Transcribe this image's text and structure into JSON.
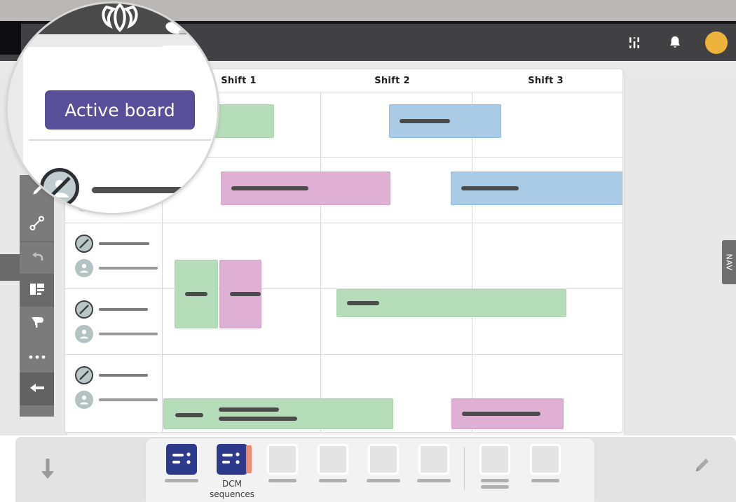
{
  "app": {
    "logo_icon": "crown-logo-icon",
    "topbar": {
      "settings_icon": "sliders-icon",
      "notifications_icon": "bell-icon",
      "avatar_label": "",
      "avatar_color": "#eeb33a",
      "background_color": "#414143"
    }
  },
  "magnifier": {
    "active_board_label": "Active board",
    "button_color": "#584f9b",
    "cursor_icon": "cursor-arrow-icon",
    "blocked_icon": "no-entry-icon",
    "redacted_line": ""
  },
  "left_rail": {
    "items": [
      {
        "name": "pen-tool",
        "icon": "pen-icon"
      },
      {
        "name": "connector-tool",
        "icon": "link-line-icon"
      },
      {
        "name": "undo",
        "icon": "undo-arrow-icon"
      },
      {
        "name": "card-layout",
        "icon": "card-layout-icon"
      },
      {
        "name": "filter",
        "icon": "funnel-icon"
      },
      {
        "name": "more-options",
        "icon": "ellipsis-icon"
      },
      {
        "name": "collapse-back",
        "icon": "arrow-left-icon"
      }
    ]
  },
  "nav_tab": {
    "label": "NAV"
  },
  "board": {
    "columns": [
      "Shift 1",
      "Shift 2",
      "Shift 3"
    ],
    "rows": [
      {
        "assignee_icon": "no-entry-icon",
        "assignee_redacted": "",
        "person_icon": "person-icon",
        "person_redacted": ""
      },
      {
        "assignee_icon": "no-entry-icon",
        "assignee_redacted": "",
        "person_icon": "person-icon",
        "person_redacted": ""
      },
      {
        "assignee_icon": "no-entry-icon",
        "assignee_redacted": "",
        "person_icon": "person-icon",
        "person_redacted": ""
      },
      {
        "assignee_icon": "no-entry-icon",
        "assignee_redacted": "",
        "person_icon": "person-icon",
        "person_redacted": ""
      },
      {
        "assignee_icon": "no-entry-icon",
        "assignee_redacted": "",
        "person_icon": "person-icon",
        "person_redacted": ""
      }
    ],
    "tasks": [
      {
        "id": "task-green-r1c1",
        "color": "green",
        "label": "",
        "lines": 0
      },
      {
        "id": "task-blue-r1c2",
        "color": "blue",
        "label": "",
        "lines": 1
      },
      {
        "id": "task-pink-r2c1",
        "color": "pink",
        "label": "",
        "lines": 1
      },
      {
        "id": "task-blue-r2c3",
        "color": "blue",
        "label": "",
        "lines": 1
      },
      {
        "id": "task-green-r3c1",
        "color": "green",
        "label": "",
        "lines": 1
      },
      {
        "id": "task-pink-r3c1b",
        "color": "pink",
        "label": "",
        "lines": 1
      },
      {
        "id": "task-green-r3c2",
        "color": "green",
        "label": "",
        "lines": 1
      },
      {
        "id": "task-green-r5c1",
        "color": "green",
        "label": "",
        "lines": 3
      },
      {
        "id": "task-pink-r5c3",
        "color": "pink",
        "label": "",
        "lines": 1
      }
    ],
    "colors": {
      "green": "#b6ddba",
      "pink": "#dfb0d3",
      "blue": "#a9cbe6"
    }
  },
  "dock": {
    "collapse_icon": "arrow-down-icon",
    "edit_icon": "pencil-icon",
    "items": [
      {
        "name": "dock-app-1",
        "caption": "",
        "tile": "blue",
        "redacted": true
      },
      {
        "name": "dock-app-dcm",
        "caption": "DCM\nsequences",
        "caption_line1": "DCM",
        "caption_line2": "sequences",
        "tile": "blue2",
        "redacted": false
      },
      {
        "name": "dock-app-3",
        "caption": "",
        "tile": "empty",
        "redacted": true
      },
      {
        "name": "dock-app-4",
        "caption": "",
        "tile": "empty",
        "redacted": true
      },
      {
        "name": "dock-app-5",
        "caption": "",
        "tile": "empty",
        "redacted": true
      },
      {
        "name": "dock-app-6",
        "caption": "",
        "tile": "empty",
        "redacted": true
      },
      {
        "name": "dock-app-7",
        "caption": "",
        "tile": "empty",
        "redacted": true
      },
      {
        "name": "dock-app-8",
        "caption": "",
        "tile": "empty",
        "redacted": true
      }
    ]
  }
}
